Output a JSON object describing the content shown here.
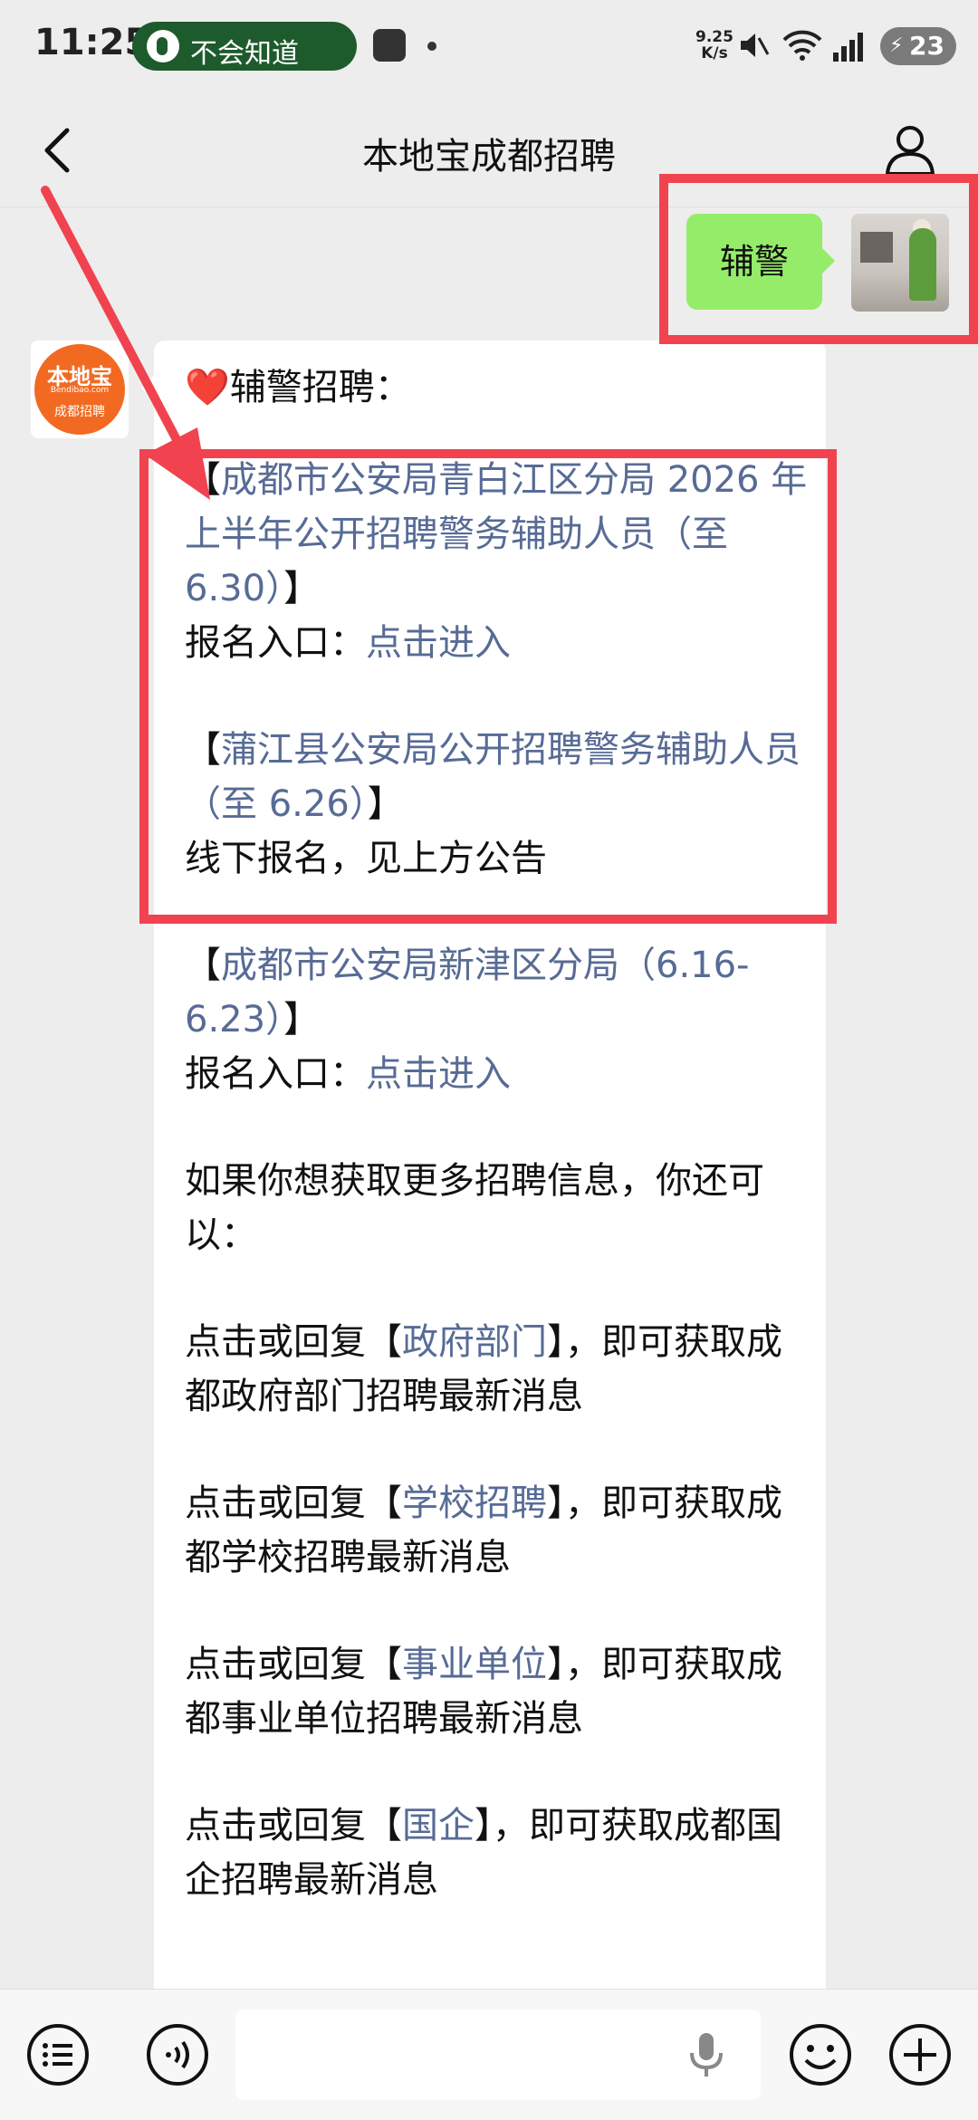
{
  "status_bar": {
    "time": "11:25",
    "pill_text": "不会知道",
    "net_speed_value": "9.25",
    "net_speed_unit": "K/s",
    "battery": "23"
  },
  "nav": {
    "title": "本地宝成都招聘"
  },
  "user_message": {
    "text": "辅警"
  },
  "bot": {
    "logo_top": "本地宝",
    "logo_mid": "Bendibao.com",
    "logo_bottom": "成都招聘",
    "heading": "辅警招聘：",
    "heart": "❤️",
    "items": [
      {
        "bracket_open": "【",
        "link": "成都市公安局青白江区分局 2026 年上半年公开招聘警务辅助人员（至 6.30）",
        "bracket_close": "】",
        "line2_prefix": "报名入口：",
        "line2_link": "点击进入"
      },
      {
        "bracket_open": "【",
        "link": "蒲江县公安局公开招聘警务辅助人员（至 6.26）",
        "bracket_close": "】",
        "line2_text": "线下报名，见上方公告"
      },
      {
        "bracket_open": "【",
        "link": "成都市公安局新津区分局（6.16-6.23）",
        "bracket_close": "】",
        "line2_prefix": "报名入口：",
        "line2_link": "点击进入"
      }
    ],
    "more_info": "如果你想获取更多招聘信息，你还可以：",
    "replies": [
      {
        "prefix": "点击或回复【",
        "link": "政府部门",
        "suffix": "】，即可获取成都政府部门招聘最新消息"
      },
      {
        "prefix": "点击或回复【",
        "link": "学校招聘",
        "suffix": "】，即可获取成都学校招聘最新消息"
      },
      {
        "prefix": "点击或回复【",
        "link": "事业单位",
        "suffix": "】，即可获取成都事业单位招聘最新消息"
      },
      {
        "prefix": "点击或回复【",
        "link": "国企",
        "suffix": "】，即可获取成都国企招聘最新消息"
      }
    ]
  },
  "colors": {
    "link": "#576b95",
    "bubble_green": "#95ec69",
    "annotation_red": "#f1434f",
    "background": "#ededed"
  }
}
